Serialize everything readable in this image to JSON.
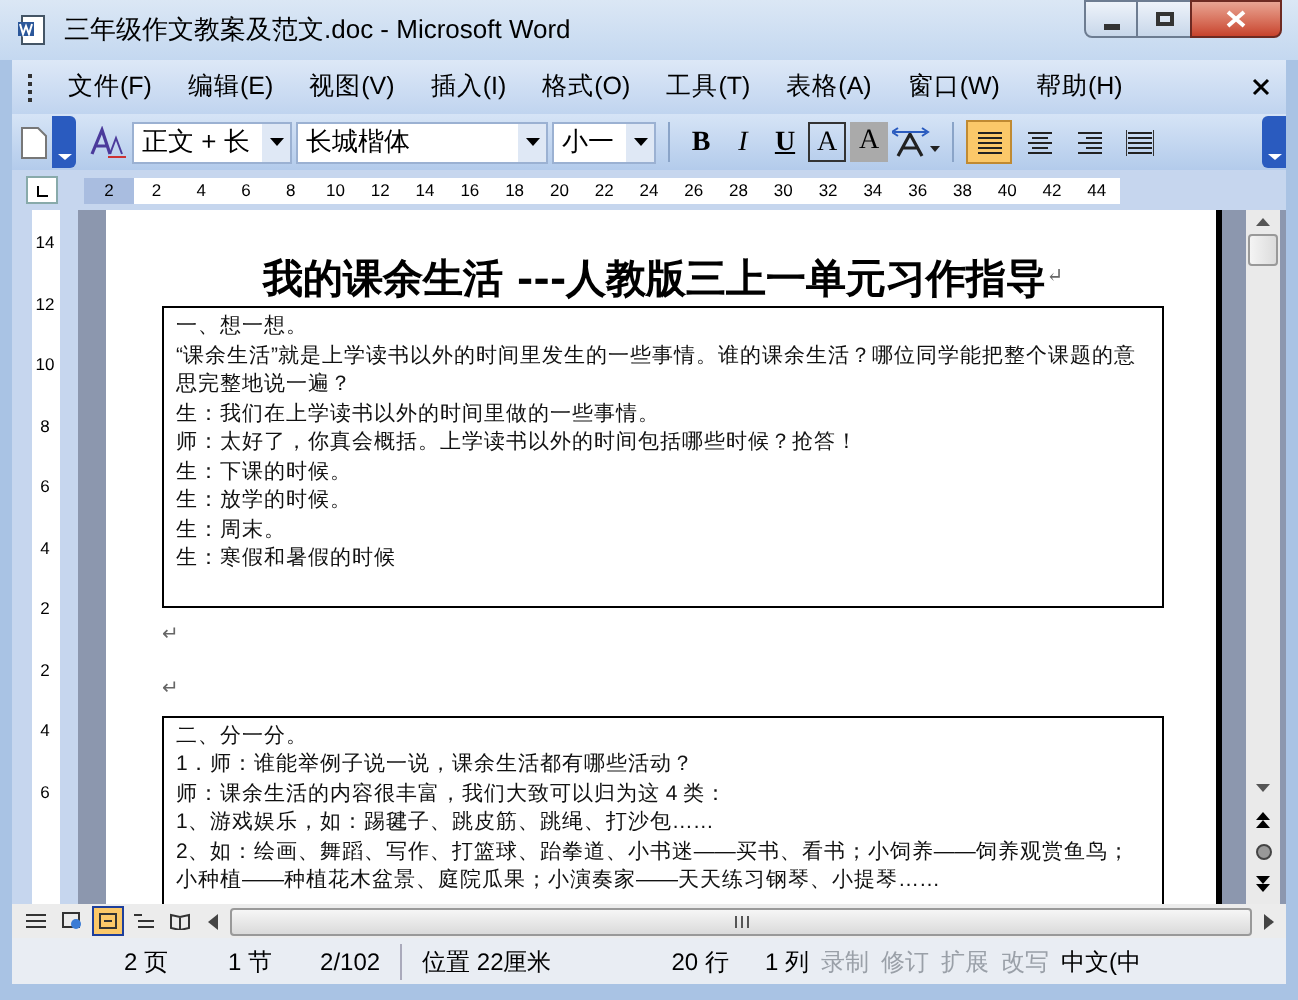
{
  "window": {
    "title": "三年级作文教案及范文.doc - Microsoft Word"
  },
  "menu": [
    "文件(F)",
    "编辑(E)",
    "视图(V)",
    "插入(I)",
    "格式(O)",
    "工具(T)",
    "表格(A)",
    "窗口(W)",
    "帮助(H)"
  ],
  "toolbar": {
    "style": "正文 + 长",
    "font": "长城楷体",
    "size": "小一",
    "buttons": [
      {
        "kind": "bold",
        "label": "B"
      },
      {
        "kind": "italic",
        "label": "I"
      },
      {
        "kind": "underline",
        "label": "U"
      },
      {
        "kind": "border",
        "label": "A"
      },
      {
        "kind": "shade",
        "label": "A"
      }
    ],
    "align": [
      {
        "kind": "justify",
        "selected": true
      },
      {
        "kind": "center",
        "selected": false
      },
      {
        "kind": "right",
        "selected": false
      },
      {
        "kind": "distribute",
        "selected": false
      }
    ]
  },
  "horizontal_ruler": [
    "2",
    "2",
    "4",
    "6",
    "8",
    "10",
    "12",
    "14",
    "16",
    "18",
    "20",
    "22",
    "24",
    "26",
    "28",
    "30",
    "32",
    "34",
    "36",
    "38",
    "40",
    "42",
    "44"
  ],
  "vertical_ruler": [
    "14",
    "12",
    "10",
    "8",
    "6",
    "4",
    "2",
    "2",
    "4",
    "6"
  ],
  "document": {
    "title": "我的课余生活 ---人教版三上一单元习作指导",
    "title_mark": "↵",
    "blocks": [
      {
        "kind": "box",
        "lines": [
          "一、想一想。",
          "“课余生活”就是上学读书以外的时间里发生的一些事情。谁的课余生活？哪位同学能把整个课题的意思完整地说一遍？",
          "生：我们在上学读书以外的时间里做的一些事情。",
          "师：太好了，你真会概括。上学读书以外的时间包括哪些时候？抢答！",
          "生：下课的时候。",
          "生：放学的时候。",
          "生：周末。",
          "生：寒假和暑假的时候"
        ]
      },
      {
        "kind": "mark",
        "text": "↵"
      },
      {
        "kind": "mark",
        "text": "↵"
      },
      {
        "kind": "box",
        "lines": [
          "二、分一分。",
          "1．师：谁能举例子说一说，课余生活都有哪些活动？",
          "师：课余生活的内容很丰富，我们大致可以归为这 4 类：",
          "1、游戏娱乐，如：踢毽子、跳皮筋、跳绳、打沙包……",
          "2、如：绘画、舞蹈、写作、打篮球、跆拳道、小书迷——买书、看书；小饲养——饲养观赏鱼鸟；小种植——种植花木盆景、庭院瓜果；小演奏家——天天练习钢琴、小提琴……"
        ]
      }
    ]
  },
  "view_buttons": [
    {
      "kind": "normal",
      "selected": false
    },
    {
      "kind": "web",
      "selected": false
    },
    {
      "kind": "print",
      "selected": true
    },
    {
      "kind": "outline",
      "selected": false
    },
    {
      "kind": "reading",
      "selected": false
    }
  ],
  "status_bar": [
    {
      "kind": "text",
      "text": "2 页"
    },
    {
      "kind": "text",
      "text": "1 节"
    },
    {
      "kind": "text",
      "text": "2/102"
    },
    {
      "kind": "sep"
    },
    {
      "kind": "text",
      "text": "位置 22厘米"
    },
    {
      "kind": "text",
      "text": "20 行"
    },
    {
      "kind": "text",
      "text": "1 列"
    },
    {
      "kind": "mode",
      "text": "录制",
      "disabled": true
    },
    {
      "kind": "mode",
      "text": "修订",
      "disabled": true
    },
    {
      "kind": "mode",
      "text": "扩展",
      "disabled": true
    },
    {
      "kind": "mode",
      "text": "改写",
      "disabled": true
    },
    {
      "kind": "mode",
      "text": "中文(中",
      "disabled": false
    }
  ]
}
